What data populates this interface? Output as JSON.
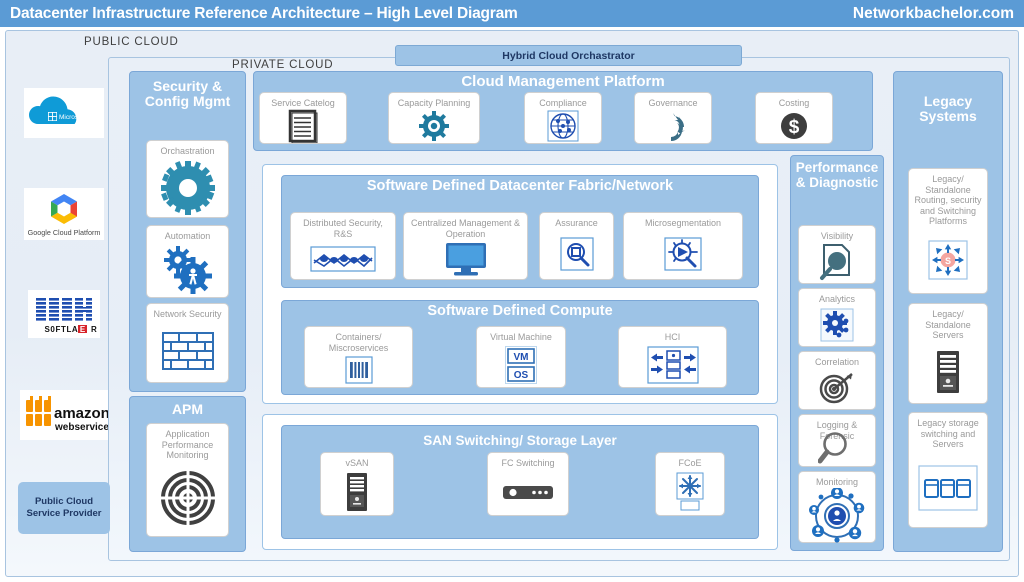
{
  "header": {
    "title": "Datacenter Infrastructure Reference Architecture – High Level Diagram",
    "brand": "Networkbachelor.com",
    "bar_color": "#5b9bd5"
  },
  "zones": {
    "public_cloud_label": "PUBLIC CLOUD",
    "private_cloud_label": "PRIVATE CLOUD",
    "hybrid_orchestrator": "Hybrid Cloud Orchastrator"
  },
  "public_cloud_providers": {
    "logos": [
      {
        "name": "microsoft-azure",
        "text": "Microsoft Azure"
      },
      {
        "name": "google-cloud-platform",
        "text": "Google Cloud Platform"
      },
      {
        "name": "ibm-softlayer",
        "text": "IBM",
        "sub": "SOFTLAYER"
      },
      {
        "name": "amazon-web-services",
        "text": "amazon",
        "sub": "webservices"
      }
    ],
    "legend": "Public Cloud\nService Provider",
    "legend_line1": "Public Cloud",
    "legend_line2": "Service Provider"
  },
  "security_config": {
    "title": "Security & Config Mgmt",
    "tiles": [
      {
        "label": "Orchastration",
        "icon": "gear-icon"
      },
      {
        "label": "Automation",
        "icon": "automation-gears-icon"
      },
      {
        "label": "Network Security",
        "icon": "firewall-brick-icon"
      }
    ]
  },
  "apm": {
    "title": "APM",
    "tiles": [
      {
        "label": "Application Performance Monitoring",
        "icon": "radar-target-icon"
      }
    ]
  },
  "cloud_management_platform": {
    "title": "Cloud Management Platform",
    "tiles": [
      {
        "label": "Service Catelog",
        "icon": "document-lines-icon"
      },
      {
        "label": "Capacity Planning",
        "icon": "cog-sun-icon"
      },
      {
        "label": "Compliance",
        "icon": "globe-network-icon"
      },
      {
        "label": "Governance",
        "icon": "recycle-arrows-icon"
      },
      {
        "label": "Costing",
        "icon": "dollar-coin-icon"
      }
    ]
  },
  "sddc_fabric": {
    "title": "Software Defined Datacenter Fabric/Network",
    "tiles": [
      {
        "label": "Distributed Security, R&S",
        "icon": "network-mesh-icon"
      },
      {
        "label": "Centralized Management & Operation",
        "icon": "monitor-icon"
      },
      {
        "label": "Assurance",
        "icon": "magnifier-square-icon"
      },
      {
        "label": "Microsegmentation",
        "icon": "segment-magnifier-icon"
      }
    ]
  },
  "sdc_compute": {
    "title": "Software Defined Compute",
    "tiles": [
      {
        "label": "Containers/ Miscroservices",
        "icon": "container-grid-icon"
      },
      {
        "label": "Virtual Machine",
        "icon": "vm-os-icon",
        "badge1": "VM",
        "badge2": "OS"
      },
      {
        "label": "HCI",
        "icon": "hci-arrows-icon"
      }
    ]
  },
  "san_storage": {
    "title": "SAN Switching/ Storage Layer",
    "tiles": [
      {
        "label": "vSAN",
        "icon": "server-tower-icon"
      },
      {
        "label": "FC Switching",
        "icon": "switch-chassis-icon"
      },
      {
        "label": "FCoE",
        "icon": "fabric-star-icon"
      }
    ]
  },
  "performance_diagnostic": {
    "title": "Performance & Diagnostic",
    "tiles": [
      {
        "label": "Visibility",
        "icon": "doc-magnifier-icon"
      },
      {
        "label": "Analytics",
        "icon": "analytics-gear-icon"
      },
      {
        "label": "Correlation",
        "icon": "target-arrow-icon"
      },
      {
        "label": "Logging & Forensic",
        "icon": "magnifier-icon"
      },
      {
        "label": "Monitoring",
        "icon": "users-network-icon"
      }
    ]
  },
  "legacy_systems": {
    "title": "Legacy Systems",
    "tiles": [
      {
        "label": "Legacy/ Standalone Routing, security and Switching Platforms",
        "icon": "router-star-icon"
      },
      {
        "label": "Legacy/ Standalone Servers",
        "icon": "server-tower-icon"
      },
      {
        "label": "Legacy storage switching and Servers",
        "icon": "storage-disks-icon"
      }
    ]
  },
  "colors": {
    "title_bar": "#5b9bd5",
    "group_fill": "#9dc3e6",
    "group_border": "#7ba7d7",
    "tile_label": "#9a9a9a",
    "zone_fill": "#e8eef6",
    "accent_teal": "#2e8eb0",
    "accent_blue": "#1f6fc0",
    "dark_gray": "#404040"
  }
}
